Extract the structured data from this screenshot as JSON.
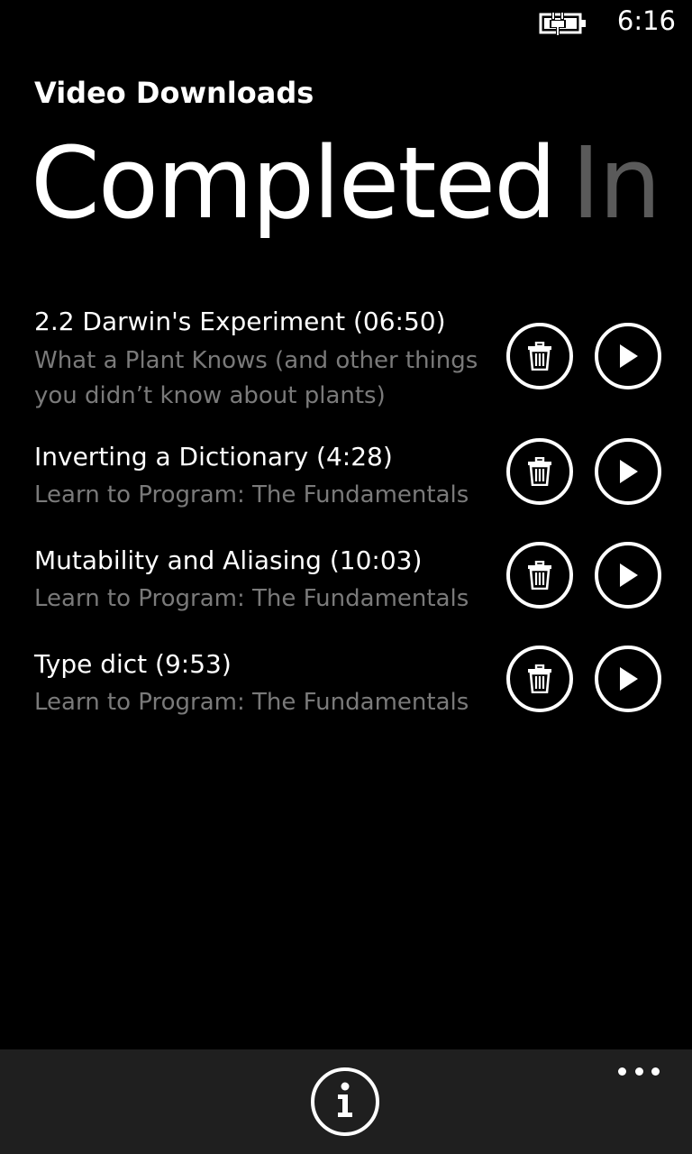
{
  "status_bar": {
    "time": "6:16",
    "battery_icon": "battery-charging-icon"
  },
  "header": {
    "app_title": "Video Downloads"
  },
  "pivot": {
    "active": "Completed",
    "next": "In P"
  },
  "downloads": [
    {
      "title": "2.2 Darwin's Experiment (06:50)",
      "course": "What a Plant Knows (and other things you didn’t know about plants)"
    },
    {
      "title": "Inverting a Dictionary (4:28)",
      "course": "Learn to Program: The Fundamentals"
    },
    {
      "title": "Mutability and Aliasing (10:03)",
      "course": "Learn to Program: The Fundamentals"
    },
    {
      "title": "Type dict (9:53)",
      "course": "Learn to Program: The Fundamentals"
    }
  ],
  "app_bar": {
    "info_icon": "info-icon",
    "more_icon": "ellipsis-icon"
  },
  "colors": {
    "background": "#000000",
    "text_primary": "#ffffff",
    "text_secondary": "#7a7a7a",
    "pivot_inactive": "#5a5a5a",
    "app_bar": "#1f1f1f"
  }
}
